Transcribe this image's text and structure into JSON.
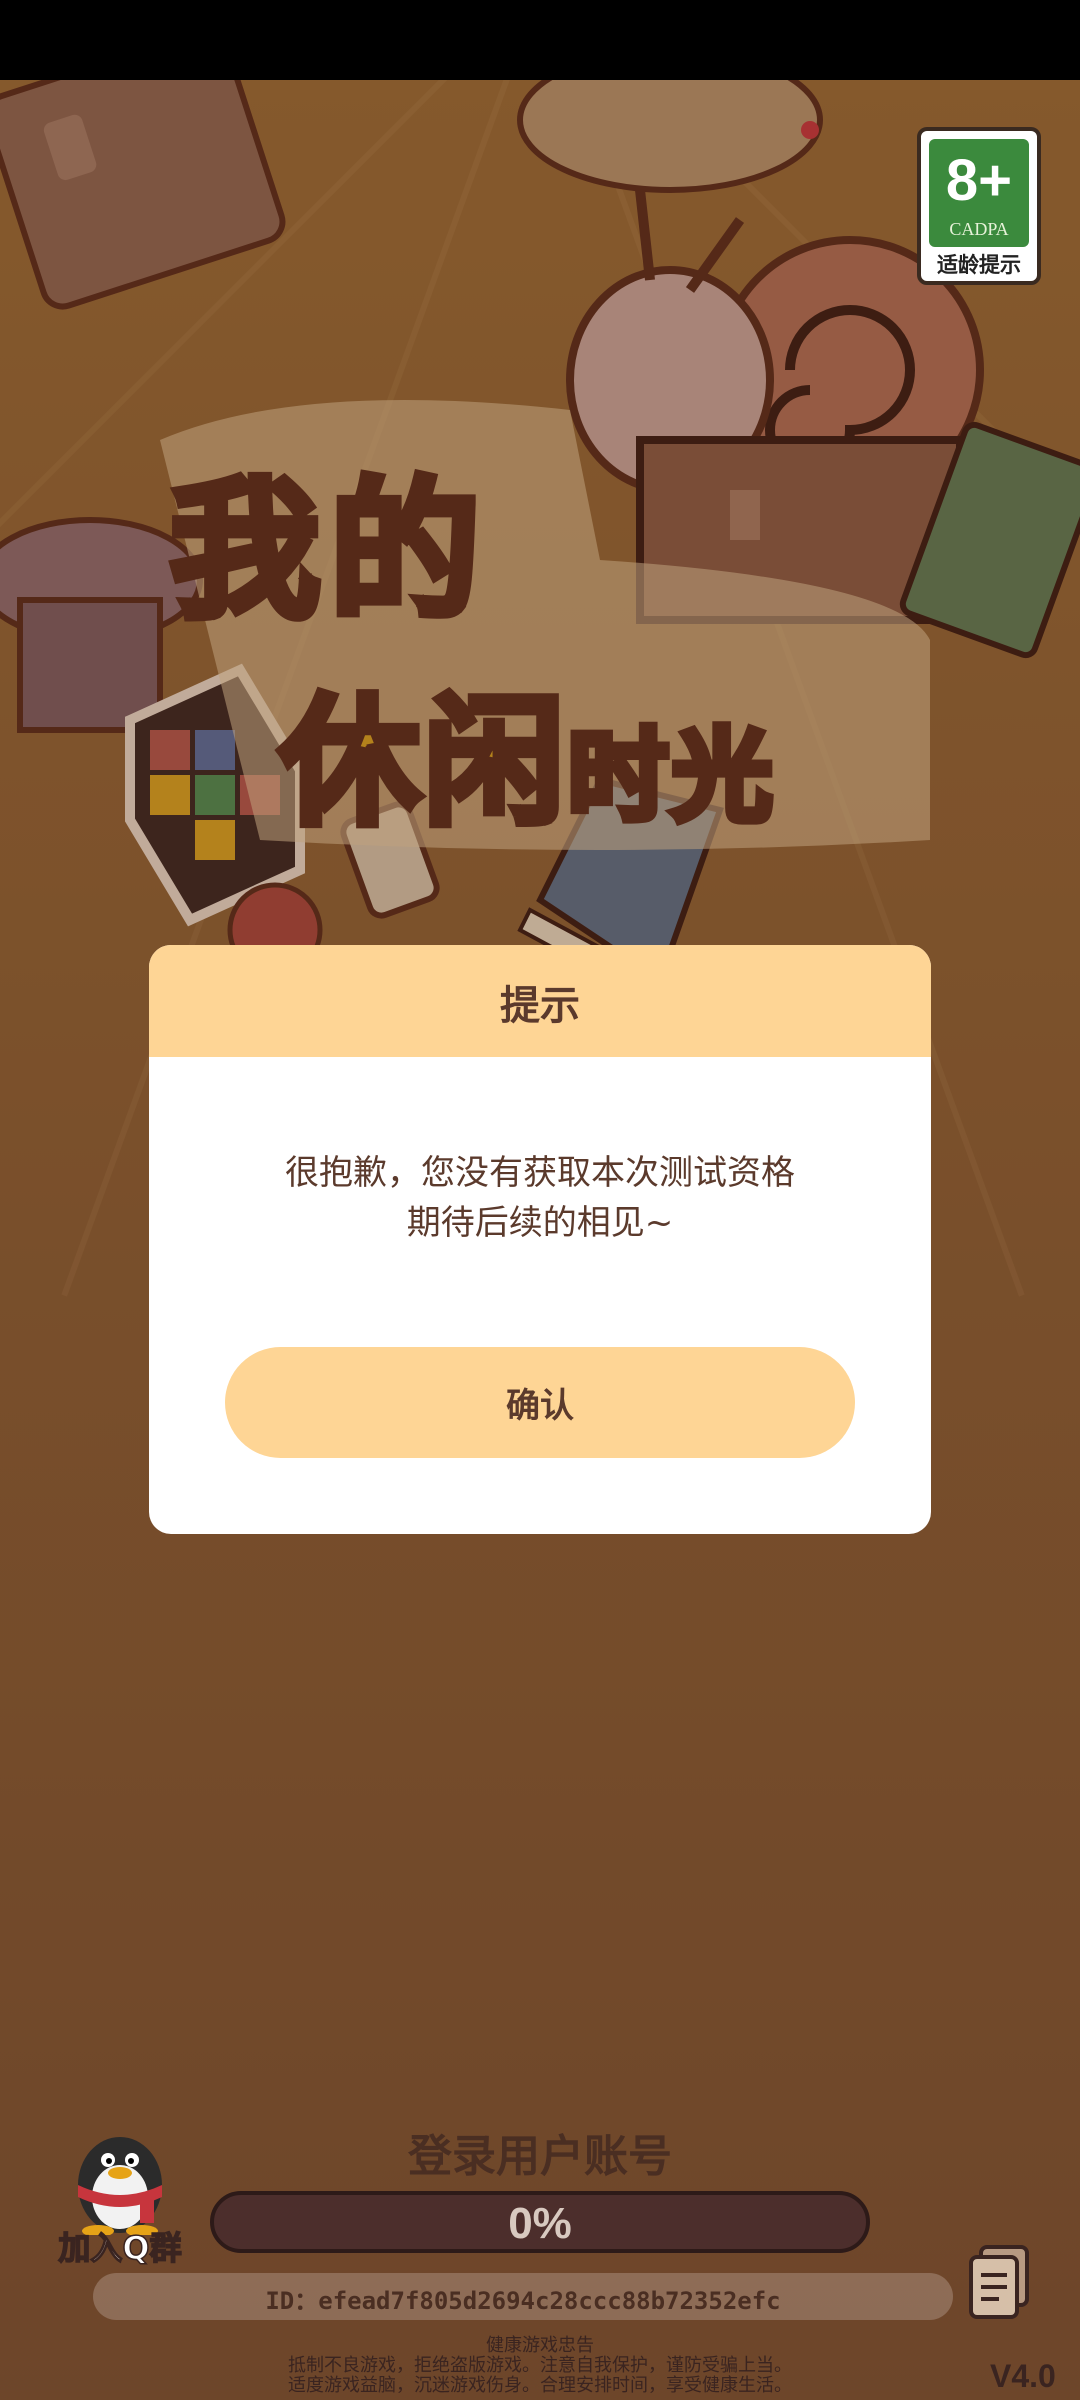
{
  "age_badge": {
    "rating": "8+",
    "org": "CADPA",
    "tip": "适龄提示"
  },
  "game_title": {
    "line1": "我的",
    "line2_big": "休闲",
    "line2_small": "时光"
  },
  "dialog": {
    "title": "提示",
    "message_line1": "很抱歉，您没有获取本次测试资格",
    "message_line2": "期待后续的相见~",
    "confirm_label": "确认"
  },
  "login": {
    "label": "登录用户账号",
    "progress_text": "0%",
    "progress_fraction": 0
  },
  "account_id": "ID：efead7f805d2694c28ccc88b72352efc",
  "qq_group_label": "加入Q群",
  "health_notice": {
    "title": "健康游戏忠告",
    "line1": "抵制不良游戏，拒绝盗版游戏。注意自我保护，谨防受骗上当。",
    "line2": "适度游戏益脑，沉迷游戏伤身。合理安排时间，享受健康生活。"
  },
  "version": "V4.0",
  "colors": {
    "dialog_header": "#fed595",
    "confirm_button": "#fed595",
    "text_brown": "#5b3a2c",
    "badge_green": "#3b8a3d"
  },
  "icons": [
    "qq-penguin-icon",
    "document-icon"
  ]
}
